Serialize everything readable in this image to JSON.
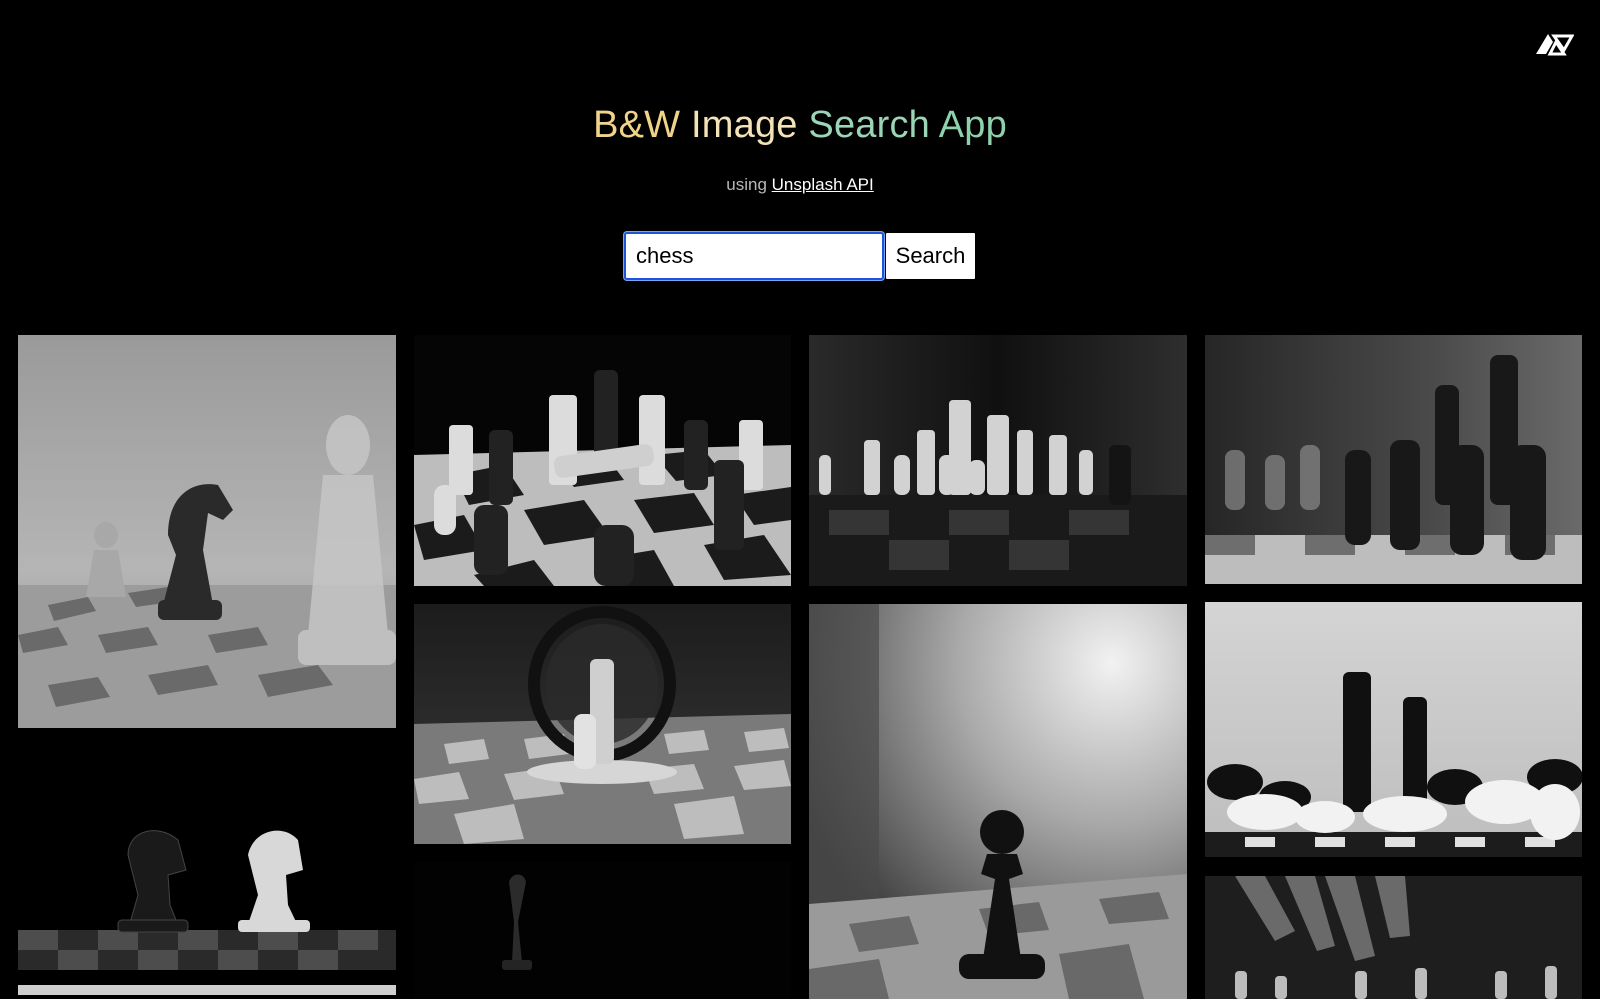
{
  "app": {
    "logo_icon": "av-triangle-logo-icon",
    "title_parts": [
      "B&W",
      "Image",
      "Search",
      "App"
    ],
    "subtitle_prefix": "using",
    "subtitle_link": "Unsplash API"
  },
  "search": {
    "value": "chess",
    "placeholder": "",
    "button_label": "Search"
  },
  "gallery": {
    "images": [
      {
        "subject": "knight between pawn and king on chessboard"
      },
      {
        "subject": "chess pieces on board with fallen piece"
      },
      {
        "subject": "row of white chess pieces in dim light"
      },
      {
        "subject": "black pawns and king out of focus"
      },
      {
        "subject": "black and white knights facing each other"
      },
      {
        "subject": "king and pawn inside glass ring"
      },
      {
        "subject": "single black pawn on blurred chessboard"
      },
      {
        "subject": "black king and queen among fallen white pieces"
      },
      {
        "subject": "hand over chess pieces"
      },
      {
        "subject": "dark silhouette of chess piece"
      }
    ]
  }
}
